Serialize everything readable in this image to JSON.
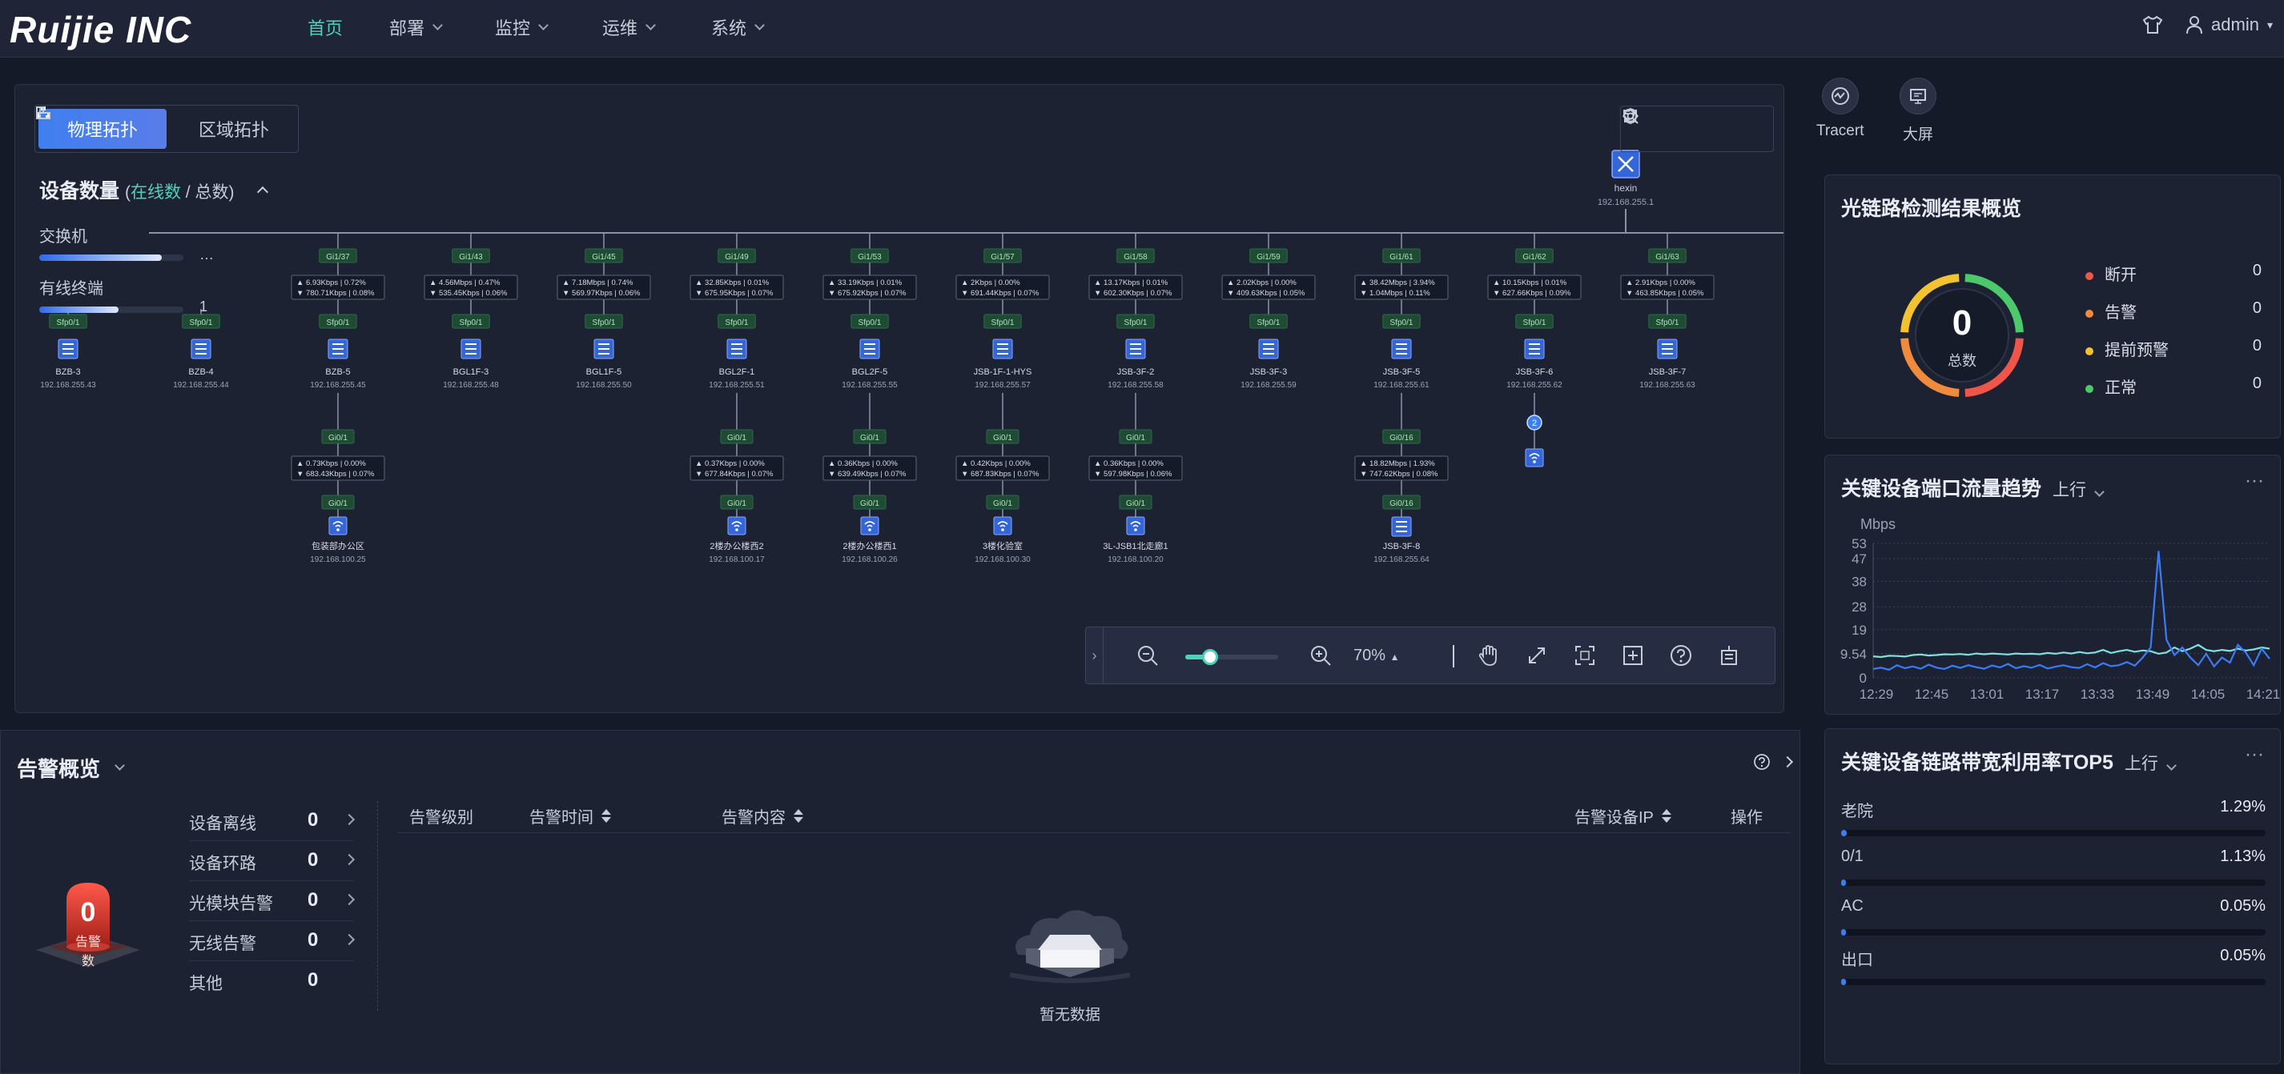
{
  "brand": "Ruijie INC",
  "nav": {
    "items": [
      {
        "label": "首页",
        "active": true,
        "has_menu": false
      },
      {
        "label": "部署",
        "active": false,
        "has_menu": true
      },
      {
        "label": "监控",
        "active": false,
        "has_menu": true
      },
      {
        "label": "运维",
        "active": false,
        "has_menu": true
      },
      {
        "label": "系统",
        "active": false,
        "has_menu": true
      }
    ],
    "user": "admin"
  },
  "topology": {
    "tabs": [
      "物理拓扑",
      "区域拓扑"
    ],
    "active_tab": "物理拓扑",
    "device_count": {
      "title": "设备数量",
      "online_label": "在线数",
      "total_label": "总数",
      "rows": [
        {
          "label": "交换机",
          "value": "…",
          "fill": 0.85
        },
        {
          "label": "有线终端",
          "value": "1",
          "fill": 0.55
        }
      ]
    },
    "core": {
      "name": "hexin",
      "ip": "192.168.255.1"
    },
    "devices": [
      {
        "port": "",
        "rate_up": "",
        "rate_down": "",
        "sfp": "Sfp0/1",
        "name": "BZB-3",
        "ip": "192.168.255.43"
      },
      {
        "port": "",
        "rate_up": "",
        "rate_down": "",
        "sfp": "Sfp0/1",
        "name": "BZB-4",
        "ip": "192.168.255.44"
      },
      {
        "port": "Gi1/37",
        "rate_up": "6.93Kbps | 0.72%",
        "rate_down": "780.71Kbps | 0.08%",
        "sfp": "Sfp0/1",
        "name": "BZB-5",
        "ip": "192.168.255.45"
      },
      {
        "port": "Gi1/43",
        "rate_up": "4.56Mbps | 0.47%",
        "rate_down": "535.45Kbps | 0.06%",
        "sfp": "Sfp0/1",
        "name": "BGL1F-3",
        "ip": "192.168.255.48"
      },
      {
        "port": "Gi1/45",
        "rate_up": "7.18Mbps | 0.74%",
        "rate_down": "569.97Kbps | 0.06%",
        "sfp": "Sfp0/1",
        "name": "BGL1F-5",
        "ip": "192.168.255.50"
      },
      {
        "port": "Gi1/49",
        "rate_up": "32.85Kbps | 0.01%",
        "rate_down": "675.95Kbps | 0.07%",
        "sfp": "Sfp0/1",
        "name": "BGL2F-1",
        "ip": "192.168.255.51"
      },
      {
        "port": "Gi1/53",
        "rate_up": "33.19Kbps | 0.01%",
        "rate_down": "675.92Kbps | 0.07%",
        "sfp": "Sfp0/1",
        "name": "BGL2F-5",
        "ip": "192.168.255.55"
      },
      {
        "port": "Gi1/57",
        "rate_up": "2Kbps | 0.00%",
        "rate_down": "691.44Kbps | 0.07%",
        "sfp": "Sfp0/1",
        "name": "JSB-1F-1-HYS",
        "ip": "192.168.255.57"
      },
      {
        "port": "Gi1/58",
        "rate_up": "13.17Kbps | 0.01%",
        "rate_down": "602.30Kbps | 0.07%",
        "sfp": "Sfp0/1",
        "name": "JSB-3F-2",
        "ip": "192.168.255.58"
      },
      {
        "port": "Gi1/59",
        "rate_up": "2.02Kbps | 0.00%",
        "rate_down": "409.63Kbps | 0.05%",
        "sfp": "Sfp0/1",
        "name": "JSB-3F-3",
        "ip": "192.168.255.59"
      },
      {
        "port": "Gi1/61",
        "rate_up": "38.42Mbps | 3.94%",
        "rate_down": "1.04Mbps | 0.11%",
        "sfp": "Sfp0/1",
        "name": "JSB-3F-5",
        "ip": "192.168.255.61"
      },
      {
        "port": "Gi1/62",
        "rate_up": "10.15Kbps | 0.01%",
        "rate_down": "627.66Kbps | 0.09%",
        "sfp": "Sfp0/1",
        "name": "JSB-3F-6",
        "ip": "192.168.255.62"
      },
      {
        "port": "Gi1/63",
        "rate_up": "2.91Kbps | 0.00%",
        "rate_down": "463.85Kbps | 0.05%",
        "sfp": "Sfp0/1",
        "name": "JSB-3F-7",
        "ip": "192.168.255.63"
      }
    ],
    "children": [
      {
        "parent": 2,
        "port_top": "Gi0/1",
        "rate_up": "0.73Kbps | 0.00%",
        "rate_down": "683.43Kbps | 0.07%",
        "port_bottom": "Gi0/1",
        "name": "包装部办公区",
        "ip": "192.168.100.25",
        "kind": "ap"
      },
      {
        "parent": 5,
        "port_top": "Gi0/1",
        "rate_up": "0.37Kbps | 0.00%",
        "rate_down": "677.84Kbps | 0.07%",
        "port_bottom": "Gi0/1",
        "name": "2楼办公楼西2",
        "ip": "192.168.100.17",
        "kind": "ap"
      },
      {
        "parent": 6,
        "port_top": "Gi0/1",
        "rate_up": "0.36Kbps | 0.00%",
        "rate_down": "639.49Kbps | 0.07%",
        "port_bottom": "Gi0/1",
        "name": "2楼办公楼西1",
        "ip": "192.168.100.26",
        "kind": "ap"
      },
      {
        "parent": 7,
        "port_top": "Gi0/1",
        "rate_up": "0.42Kbps | 0.00%",
        "rate_down": "687.83Kbps | 0.07%",
        "port_bottom": "Gi0/1",
        "name": "3楼化验室",
        "ip": "192.168.100.30",
        "kind": "ap"
      },
      {
        "parent": 8,
        "port_top": "Gi0/1",
        "rate_up": "0.36Kbps | 0.00%",
        "rate_down": "597.98Kbps | 0.06%",
        "port_bottom": "Gi0/1",
        "name": "3L-JSB1北走廊1",
        "ip": "192.168.100.20",
        "kind": "ap"
      },
      {
        "parent": 10,
        "port_top": "Gi0/16",
        "rate_up": "18.82Mbps | 1.93%",
        "rate_down": "747.62Kbps | 0.08%",
        "port_bottom": "Gi0/16",
        "name": "JSB-3F-8",
        "ip": "192.168.255.64",
        "kind": "switch"
      }
    ],
    "badge_count": "2",
    "zoom": "70%"
  },
  "rail": [
    {
      "label": "Tracert",
      "icon": "tracert-icon"
    },
    {
      "label": "大屏",
      "icon": "big-screen-icon"
    }
  ],
  "optical": {
    "title": "光链路检测结果概览",
    "total": "0",
    "total_label": "总数",
    "legend": [
      {
        "label": "断开",
        "value": "0",
        "color": "#f0554a"
      },
      {
        "label": "告警",
        "value": "0",
        "color": "#f08a3c"
      },
      {
        "label": "提前预警",
        "value": "0",
        "color": "#f2c230"
      },
      {
        "label": "正常",
        "value": "0",
        "color": "#4cc96a"
      }
    ]
  },
  "traffic": {
    "title": "关键设备端口流量趋势",
    "direction": "上行",
    "unit": "Mbps",
    "more": "···",
    "chart_data": {
      "type": "line",
      "ylabel": "Mbps",
      "yticks": [
        "53",
        "47",
        "38",
        "28",
        "19",
        "9.54",
        "0"
      ],
      "xticks": [
        "12:29",
        "12:45",
        "13:01",
        "13:17",
        "13:33",
        "13:49",
        "14:05",
        "14:21"
      ],
      "ylim": [
        0,
        53
      ],
      "series": [
        {
          "color": "#7fe0e0",
          "values": [
            8.5,
            8.2,
            8.7,
            8.6,
            8.4,
            9.0,
            9.2,
            8.8,
            9.0,
            9.3,
            9.2,
            9.4,
            9.1,
            9.6,
            9.3,
            9.6,
            9.4,
            9.2,
            9.6,
            9.4,
            9.5,
            9.3,
            9.8,
            9.5,
            10.0,
            9.6,
            10.2,
            9.7,
            10.0,
            11.0,
            9.8,
            10.5,
            11.0,
            10.3,
            10.8,
            10.5,
            9.5,
            10.0,
            12.0,
            10.5,
            11.5,
            13.0,
            11.0,
            10.5,
            11.0,
            10.6,
            11.5,
            10.8,
            11.2,
            12.0,
            11.5
          ]
        },
        {
          "color": "#3b7cf5",
          "values": [
            3.5,
            4.0,
            3.2,
            5.0,
            3.8,
            4.5,
            3.6,
            5.2,
            4.0,
            3.5,
            4.8,
            3.9,
            5.0,
            4.2,
            3.6,
            4.9,
            4.1,
            5.5,
            3.8,
            4.6,
            4.0,
            5.1,
            3.7,
            4.4,
            5.0,
            4.2,
            3.9,
            5.4,
            4.1,
            5.8,
            4.6,
            5.0,
            6.2,
            4.8,
            8.0,
            12.0,
            50.0,
            15.0,
            9.0,
            12.0,
            8.0,
            5.0,
            9.5,
            4.5,
            8.0,
            6.0,
            13.0,
            10.0,
            5.0,
            11.5,
            7.5
          ]
        }
      ]
    }
  },
  "bandwidth": {
    "title": "关键设备链路带宽利用率TOP5",
    "direction": "上行",
    "more": "···",
    "items": [
      {
        "label": "老院",
        "pct": "1.29%",
        "fill": 0.0129
      },
      {
        "label": "0/1",
        "pct": "1.13%",
        "fill": 0.0113
      },
      {
        "label": "AC",
        "pct": "0.05%",
        "fill": 0.0005
      },
      {
        "label": "出口",
        "pct": "0.05%",
        "fill": 0.0005
      }
    ]
  },
  "alarm": {
    "title": "告警概览",
    "count": "0",
    "count_label": "告警数",
    "categories": [
      {
        "label": "设备离线",
        "value": "0",
        "arrow": true
      },
      {
        "label": "设备环路",
        "value": "0",
        "arrow": true
      },
      {
        "label": "光模块告警",
        "value": "0",
        "arrow": true
      },
      {
        "label": "无线告警",
        "value": "0",
        "arrow": true
      },
      {
        "label": "其他",
        "value": "0",
        "arrow": false
      }
    ],
    "columns": {
      "level": "告警级别",
      "time": "告警时间",
      "content": "告警内容",
      "ip": "告警设备IP",
      "action": "操作"
    },
    "empty": "暂无数据"
  }
}
